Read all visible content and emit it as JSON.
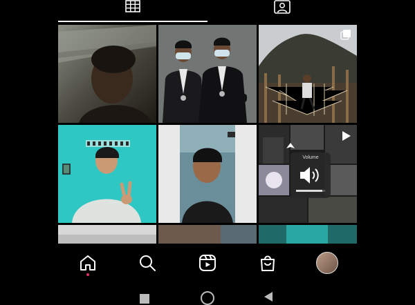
{
  "tabs": [
    {
      "name": "posts-grid",
      "icon": "grid-icon",
      "active": true
    },
    {
      "name": "tagged",
      "icon": "tagged-person-icon",
      "active": false
    }
  ],
  "grid": {
    "tiles": [
      {
        "id": "post-1",
        "badge": "none"
      },
      {
        "id": "post-2",
        "badge": "none"
      },
      {
        "id": "post-3",
        "badge": "carousel-icon"
      },
      {
        "id": "post-4",
        "badge": "none"
      },
      {
        "id": "post-5",
        "badge": "none"
      },
      {
        "id": "post-6",
        "badge": "reel-play-icon"
      },
      {
        "id": "post-7",
        "badge": "none"
      },
      {
        "id": "post-8",
        "badge": "none"
      },
      {
        "id": "post-9",
        "badge": "none"
      }
    ]
  },
  "volume_overlay": {
    "label": "Volume",
    "icon": "speaker-icon",
    "level": 0.9
  },
  "bottom_nav": [
    {
      "name": "home",
      "icon": "home-icon",
      "active": true
    },
    {
      "name": "search",
      "icon": "search-icon",
      "active": false
    },
    {
      "name": "reels",
      "icon": "reels-icon",
      "active": false
    },
    {
      "name": "shop",
      "icon": "shop-bag-icon",
      "active": false
    },
    {
      "name": "profile",
      "icon": "avatar-icon",
      "active": false
    }
  ],
  "system_nav": [
    "recents-button",
    "home-button",
    "back-button"
  ],
  "colors": {
    "background": "#000000",
    "notification_dot": "#e1306c",
    "teal_wall": "#2ec7c4"
  }
}
